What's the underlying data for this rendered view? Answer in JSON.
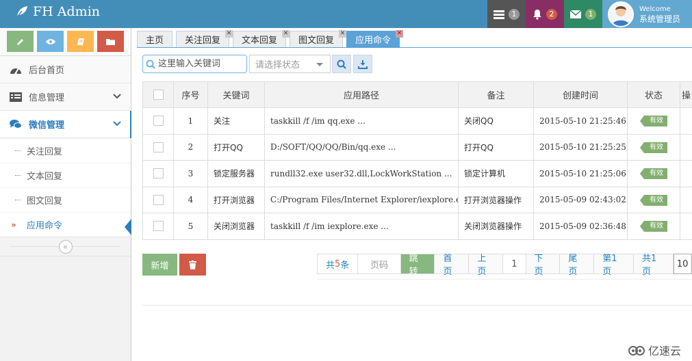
{
  "header": {
    "brand": "FH Admin",
    "tasks_count": "1",
    "notifications_count": "2",
    "messages_count": "1",
    "welcome": "Welcome",
    "username": "系统管理员"
  },
  "sidebar": {
    "items": [
      {
        "label": "后台首页"
      },
      {
        "label": "信息管理"
      },
      {
        "label": "微信管理"
      }
    ],
    "submenu": [
      {
        "label": "关注回复"
      },
      {
        "label": "文本回复"
      },
      {
        "label": "图文回复"
      },
      {
        "label": "应用命令"
      }
    ]
  },
  "tabs": [
    {
      "label": "主页"
    },
    {
      "label": "关注回复"
    },
    {
      "label": "文本回复"
    },
    {
      "label": "图文回复"
    },
    {
      "label": "应用命令"
    }
  ],
  "search": {
    "placeholder": "这里输入关键词",
    "status_placeholder": "请选择状态"
  },
  "table": {
    "headers": [
      "序号",
      "关键词",
      "应用路径",
      "备注",
      "创建时间",
      "状态",
      "操"
    ],
    "rows": [
      {
        "no": "1",
        "keyword": "关注",
        "path": "taskkill /f /im qq.exe ...",
        "note": "关闭QQ",
        "time": "2015-05-10 21:25:46",
        "status": "有效"
      },
      {
        "no": "2",
        "keyword": "打开QQ",
        "path": "D:/SOFT/QQ/QQ/Bin/qq.exe ...",
        "note": "打开QQ",
        "time": "2015-05-10 21:25:25",
        "status": "有效"
      },
      {
        "no": "3",
        "keyword": "锁定服务器",
        "path": "rundll32.exe user32.dll,LockWorkStation ...",
        "note": "锁定计算机",
        "time": "2015-05-10 21:25:06",
        "status": "有效"
      },
      {
        "no": "4",
        "keyword": "打开浏览器",
        "path": "C:/Program Files/Internet Explorer/iexplore.exe ...",
        "note": "打开浏览器操作",
        "time": "2015-05-09 02:43:02",
        "status": "有效"
      },
      {
        "no": "5",
        "keyword": "关闭浏览器",
        "path": "taskkill /f /im iexplore.exe ...",
        "note": "关闭浏览器操作",
        "time": "2015-05-09 02:36:48",
        "status": "有效"
      }
    ]
  },
  "actions": {
    "add_label": "新增"
  },
  "pager": {
    "total_prefix": "共",
    "total_count": "5",
    "total_suffix": "条",
    "page_placeholder": "页码",
    "jump": "跳转",
    "first": "首页",
    "prev": "上页",
    "current": "1",
    "next": "下页",
    "last": "尾页",
    "page_info": "第1页",
    "total_pages": "共1页",
    "page_size": "10"
  },
  "watermark": "亿速云",
  "colors": {
    "navbar": "#438eb9",
    "accent": "#2b7dbc",
    "success": "#87b87f",
    "danger": "#d15b47"
  }
}
